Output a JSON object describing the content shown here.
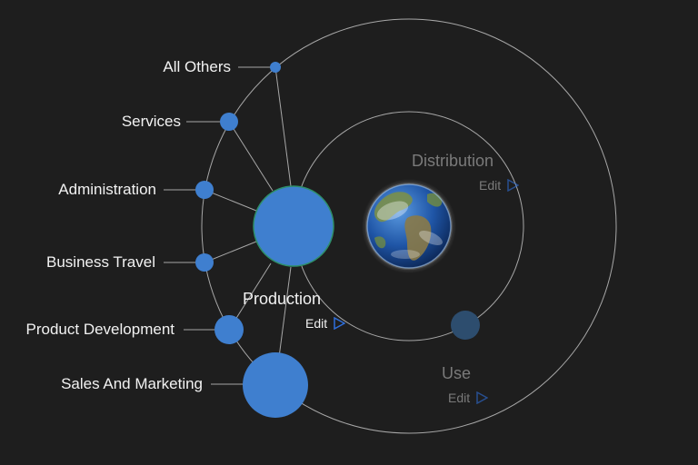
{
  "colors": {
    "background": "#1e1e1e",
    "node": "#3f7fcf",
    "node_dim": "#2d4d6e",
    "orbit": "#bfbfbf",
    "text": "#f2f2f2",
    "text_dim": "#7a7a7a",
    "accent_triangle": "#2f6fdc"
  },
  "categories": [
    {
      "label": "All Others"
    },
    {
      "label": "Services"
    },
    {
      "label": "Administration"
    },
    {
      "label": "Business Travel"
    },
    {
      "label": "Product Development"
    },
    {
      "label": "Sales And Marketing"
    }
  ],
  "phases": {
    "production": {
      "label": "Production",
      "edit_label": "Edit"
    },
    "distribution": {
      "label": "Distribution",
      "edit_label": "Edit"
    },
    "use": {
      "label": "Use",
      "edit_label": "Edit"
    }
  },
  "icons": {
    "center": "earth-globe-icon",
    "edit": "play-triangle-icon"
  }
}
